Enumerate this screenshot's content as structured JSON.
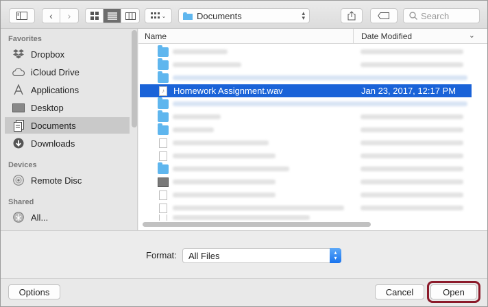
{
  "toolbar": {
    "location": "Documents",
    "search_placeholder": "Search"
  },
  "sidebar": {
    "sections": [
      {
        "heading": "Favorites"
      },
      {
        "heading": "Devices"
      },
      {
        "heading": "Shared"
      }
    ],
    "favorites": [
      {
        "label": "Dropbox",
        "icon": "dropbox-icon"
      },
      {
        "label": "iCloud Drive",
        "icon": "cloud-icon"
      },
      {
        "label": "Applications",
        "icon": "applications-icon"
      },
      {
        "label": "Desktop",
        "icon": "desktop-icon"
      },
      {
        "label": "Documents",
        "icon": "documents-icon",
        "selected": true
      },
      {
        "label": "Downloads",
        "icon": "downloads-icon"
      }
    ],
    "devices": [
      {
        "label": "Remote Disc",
        "icon": "disc-icon"
      }
    ],
    "shared": [
      {
        "label": "All...",
        "icon": "network-icon"
      }
    ]
  },
  "file_list": {
    "columns": [
      "Name",
      "Date Modified"
    ],
    "selected_row": {
      "name": "Homework Assignment.wav",
      "date": "Jan 23, 2017, 12:17 PM"
    }
  },
  "format": {
    "label": "Format:",
    "value": "All Files"
  },
  "buttons": {
    "options": "Options",
    "cancel": "Cancel",
    "open": "Open"
  },
  "colors": {
    "selection": "#1a63d8",
    "folder": "#5fb6ee",
    "highlight_ring": "#8b1a2a"
  }
}
